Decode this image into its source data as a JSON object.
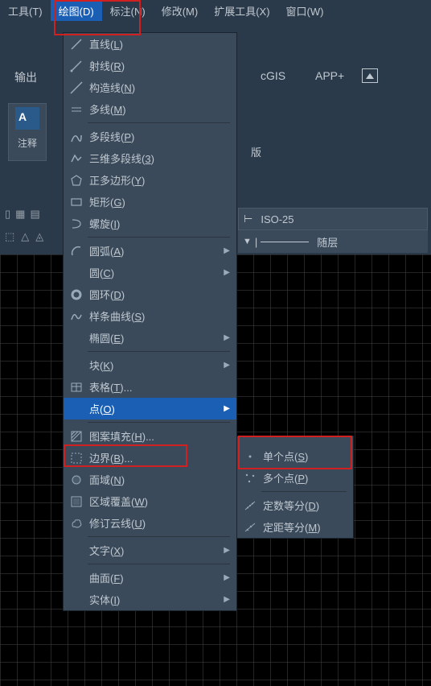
{
  "menubar": {
    "items": [
      "工具(T)",
      "绘图(D)",
      "标注(N)",
      "修改(M)",
      "扩展工具(X)",
      "窗口(W)"
    ]
  },
  "ribbon": {
    "output": "输出",
    "cgis": "cGIS",
    "app": "APP+",
    "annotation": "注释",
    "ban": "版",
    "iso": "ISO-25",
    "layer": "随层"
  },
  "draw_menu": {
    "items": [
      {
        "label": "直线(L)",
        "icon": "line"
      },
      {
        "label": "射线(R)",
        "icon": "ray"
      },
      {
        "label": "构造线(N)",
        "icon": "xline"
      },
      {
        "label": "多线(M)",
        "icon": "mline"
      },
      {
        "sep": true
      },
      {
        "label": "多段线(P)",
        "icon": "pline"
      },
      {
        "label": "三维多段线(3)",
        "icon": "3dpline"
      },
      {
        "label": "正多边形(Y)",
        "icon": "polygon"
      },
      {
        "label": "矩形(G)",
        "icon": "rect"
      },
      {
        "label": "螺旋(I)",
        "icon": "helix"
      },
      {
        "sep": true
      },
      {
        "label": "圆弧(A)",
        "icon": "arc",
        "sub": true
      },
      {
        "label": "圆(C)",
        "icon": "circle-ph",
        "sub": true
      },
      {
        "label": "圆环(D)",
        "icon": "donut"
      },
      {
        "label": "样条曲线(S)",
        "icon": "spline"
      },
      {
        "label": "椭圆(E)",
        "icon": "ellipse-ph",
        "sub": true
      },
      {
        "sep": true
      },
      {
        "label": "块(K)",
        "icon": "",
        "sub": true
      },
      {
        "label": "表格(T)...",
        "icon": "table"
      },
      {
        "label": "点(O)",
        "icon": "",
        "sub": true,
        "hl": true
      },
      {
        "sep": true
      },
      {
        "label": "图案填充(H)...",
        "icon": "hatch"
      },
      {
        "label": "边界(B)...",
        "icon": "boundary"
      },
      {
        "label": "面域(N)",
        "icon": "region"
      },
      {
        "label": "区域覆盖(W)",
        "icon": "wipeout"
      },
      {
        "label": "修订云线(U)",
        "icon": "revcloud"
      },
      {
        "sep": true
      },
      {
        "label": "文字(X)",
        "icon": "",
        "sub": true
      },
      {
        "sep": true
      },
      {
        "label": "曲面(F)",
        "icon": "",
        "sub": true
      },
      {
        "label": "实体(I)",
        "icon": "",
        "sub": true
      }
    ]
  },
  "point_submenu": {
    "items": [
      {
        "label": "单个点(S)",
        "icon": "point"
      },
      {
        "label": "多个点(P)",
        "icon": "mpoint"
      },
      {
        "sep": true
      },
      {
        "label": "定数等分(D)",
        "icon": "divide"
      },
      {
        "label": "定距等分(M)",
        "icon": "measure"
      }
    ]
  }
}
